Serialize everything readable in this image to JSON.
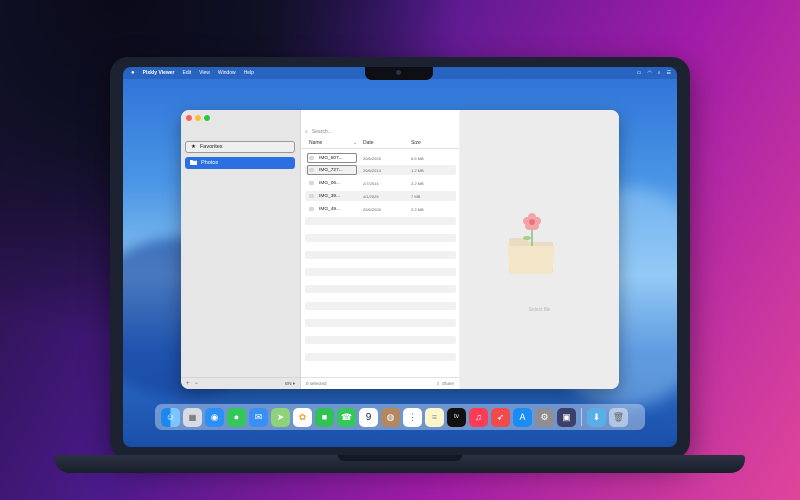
{
  "menubar": {
    "app_name": "Pixkly Viewer",
    "menus": [
      "Edit",
      "View",
      "Window",
      "Help"
    ]
  },
  "sidebar": {
    "items": [
      {
        "label": "Favorites",
        "icon": "star-icon"
      },
      {
        "label": "Photos",
        "icon": "folder-icon"
      }
    ],
    "footer": {
      "add": "+",
      "remove": "−",
      "language": "EN ▾"
    }
  },
  "list": {
    "search_placeholder": "Search...",
    "columns": {
      "name": "Name",
      "date": "Date",
      "size": "Size"
    },
    "rows": [
      {
        "name": "IMG_507...",
        "date": "20/6/2025",
        "size": "6.5 MB"
      },
      {
        "name": "IMG_727...",
        "date": "20/6/2014",
        "size": "1.2 MB"
      },
      {
        "name": "IMG_06...",
        "date": "2/7/2014",
        "size": "2.2 MB"
      },
      {
        "name": "IMG_39...",
        "date": "4/1/2025",
        "size": "7 MB"
      },
      {
        "name": "IMG_49...",
        "date": "20/6/2025",
        "size": "2.2 MB"
      }
    ],
    "footer": {
      "selected": "0 selected",
      "share": "Share"
    }
  },
  "detail": {
    "placeholder": "Select file"
  },
  "colors": {
    "accent": "#2b6fe0",
    "close": "#ff5f57",
    "minimize": "#febc2e",
    "zoom": "#28c840"
  },
  "dock": {
    "icons": [
      "finder-icon",
      "launchpad-icon",
      "safari-icon",
      "messages-icon",
      "mail-icon",
      "maps-icon",
      "photos-icon",
      "facetime-icon",
      "phone-icon",
      "calendar-icon",
      "contacts-icon",
      "reminders-icon",
      "notes-icon",
      "tv-icon",
      "music-icon",
      "rocket-icon",
      "appstore-icon",
      "settings-icon",
      "viewer-app-icon",
      "downloads-icon",
      "trash-icon"
    ],
    "calendar_day": "9",
    "tv_label": "tv"
  }
}
